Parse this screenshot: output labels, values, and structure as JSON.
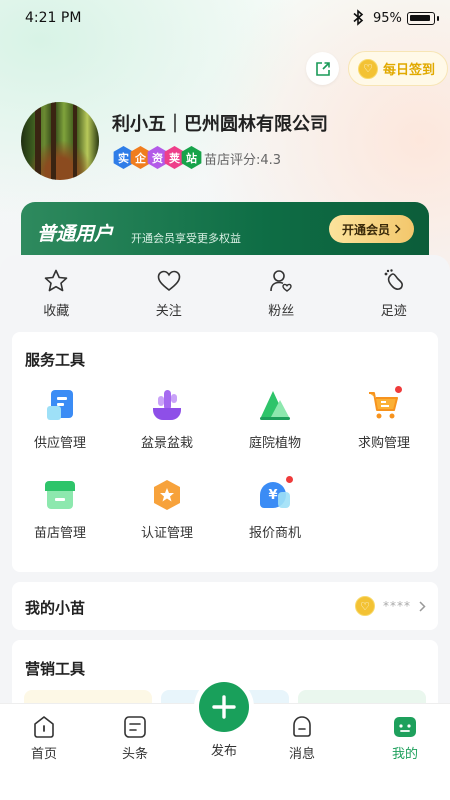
{
  "status": {
    "time": "4:21 PM",
    "battery": "95%"
  },
  "header": {
    "checkin_label": "每日签到"
  },
  "profile": {
    "name": "利小五｜巴州圆林有限公司",
    "badges": [
      {
        "text": "实",
        "color": "#2f7de8"
      },
      {
        "text": "企",
        "color": "#f07d1e"
      },
      {
        "text": "资",
        "color": "#b35ae8"
      },
      {
        "text": "荚",
        "color": "#ee3f8a"
      },
      {
        "text": "站",
        "color": "#16a34a"
      }
    ],
    "rating": "苗店评分:4.3"
  },
  "vip": {
    "title": "普通用户",
    "subtitle": "开通会员享受更多权益",
    "button": "开通会员"
  },
  "stats": [
    {
      "label": "收藏",
      "icon": "star-icon"
    },
    {
      "label": "关注",
      "icon": "heart-icon"
    },
    {
      "label": "粉丝",
      "icon": "person-heart-icon"
    },
    {
      "label": "足迹",
      "icon": "footprint-icon"
    }
  ],
  "services": {
    "title": "服务工具",
    "items": [
      {
        "label": "供应管理",
        "icon": "document-icon"
      },
      {
        "label": "盆景盆栽",
        "icon": "cactus-pot-icon"
      },
      {
        "label": "庭院植物",
        "icon": "tree-icon"
      },
      {
        "label": "求购管理",
        "icon": "shopping-cart-icon"
      },
      {
        "label": "苗店管理",
        "icon": "storefront-icon"
      },
      {
        "label": "认证管理",
        "icon": "certificate-icon"
      },
      {
        "label": "报价商机",
        "icon": "price-bubble-icon"
      }
    ]
  },
  "seedling": {
    "title": "我的小苗",
    "value": "****"
  },
  "marketing": {
    "title": "营销工具"
  },
  "tabbar": {
    "items": [
      {
        "label": "首页",
        "icon": "home-icon"
      },
      {
        "label": "头条",
        "icon": "headline-icon"
      },
      {
        "label": "发布",
        "icon": "plus-icon"
      },
      {
        "label": "消息",
        "icon": "message-icon"
      },
      {
        "label": "我的",
        "icon": "profile-icon"
      }
    ],
    "active": "我的",
    "accent": "#1ea05c"
  }
}
